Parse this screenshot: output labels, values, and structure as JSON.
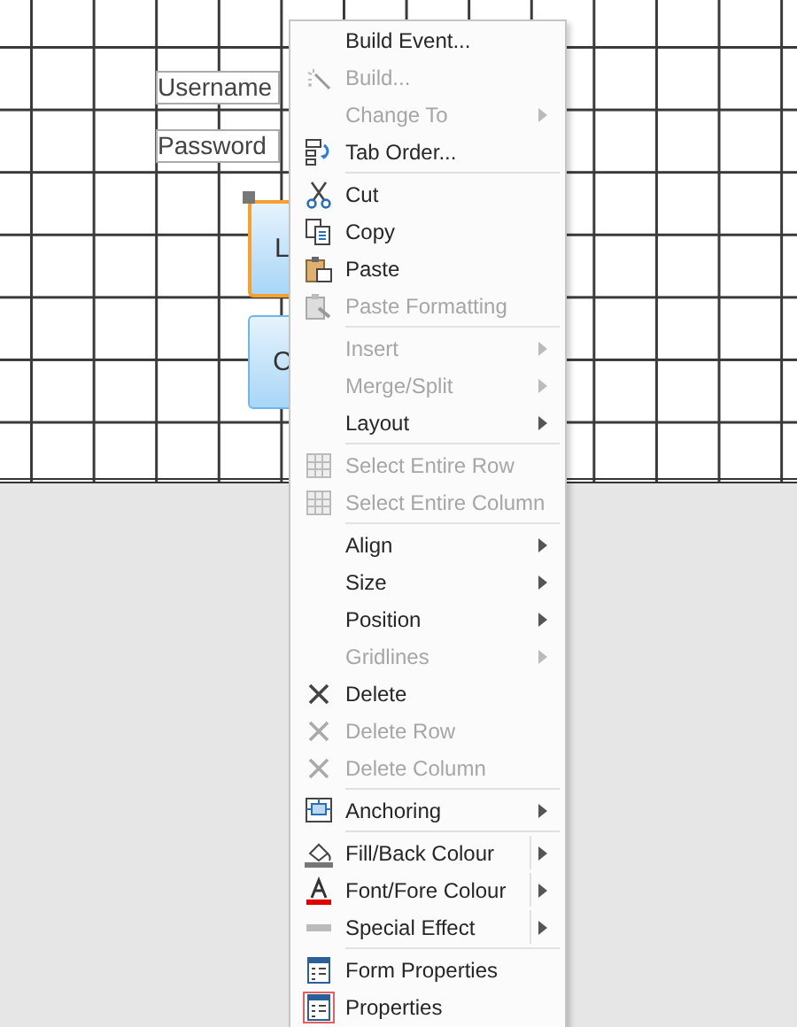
{
  "form": {
    "labels": [
      "Username",
      "Password"
    ],
    "buttons": [
      {
        "text": "L",
        "selected": true
      },
      {
        "text": "C",
        "selected": false
      }
    ]
  },
  "menu": {
    "items": [
      {
        "kind": "item",
        "label": "Build Event...",
        "disabled": false,
        "selected": false
      },
      {
        "kind": "item",
        "label": "Build...",
        "disabled": true,
        "selected": false
      },
      {
        "kind": "submenu",
        "label": "Change To",
        "disabled": true,
        "selected": false
      },
      {
        "kind": "item",
        "label": "Tab Order...",
        "disabled": false,
        "selected": false
      },
      {
        "kind": "separator"
      },
      {
        "kind": "item",
        "label": "Cut",
        "disabled": false,
        "selected": false
      },
      {
        "kind": "item",
        "label": "Copy",
        "disabled": false,
        "selected": false
      },
      {
        "kind": "item",
        "label": "Paste",
        "disabled": false,
        "selected": false
      },
      {
        "kind": "item",
        "label": "Paste Formatting",
        "disabled": true,
        "selected": false
      },
      {
        "kind": "separator"
      },
      {
        "kind": "submenu",
        "label": "Insert",
        "disabled": true,
        "selected": false
      },
      {
        "kind": "submenu",
        "label": "Merge/Split",
        "disabled": true,
        "selected": false
      },
      {
        "kind": "submenu",
        "label": "Layout",
        "disabled": false,
        "selected": false
      },
      {
        "kind": "separator"
      },
      {
        "kind": "item",
        "label": "Select Entire Row",
        "disabled": true,
        "selected": false
      },
      {
        "kind": "item",
        "label": "Select Entire Column",
        "disabled": true,
        "selected": false
      },
      {
        "kind": "separator"
      },
      {
        "kind": "submenu",
        "label": "Align",
        "disabled": false,
        "selected": false
      },
      {
        "kind": "submenu",
        "label": "Size",
        "disabled": false,
        "selected": false
      },
      {
        "kind": "submenu",
        "label": "Position",
        "disabled": false,
        "selected": false
      },
      {
        "kind": "submenu",
        "label": "Gridlines",
        "disabled": true,
        "selected": false
      },
      {
        "kind": "item",
        "label": "Delete",
        "disabled": false,
        "selected": false
      },
      {
        "kind": "item",
        "label": "Delete Row",
        "disabled": true,
        "selected": false
      },
      {
        "kind": "item",
        "label": "Delete Column",
        "disabled": true,
        "selected": false
      },
      {
        "kind": "separator"
      },
      {
        "kind": "submenu",
        "label": "Anchoring",
        "disabled": false,
        "selected": false
      },
      {
        "kind": "separator"
      },
      {
        "kind": "split",
        "label": "Fill/Back Colour",
        "disabled": false,
        "selected": false
      },
      {
        "kind": "split",
        "label": "Font/Fore Colour",
        "disabled": false,
        "selected": false
      },
      {
        "kind": "split",
        "label": "Special Effect",
        "disabled": false,
        "selected": false
      },
      {
        "kind": "separator"
      },
      {
        "kind": "item",
        "label": "Form Properties",
        "disabled": false,
        "selected": false
      },
      {
        "kind": "item",
        "label": "Properties",
        "disabled": false,
        "selected": true
      }
    ]
  }
}
